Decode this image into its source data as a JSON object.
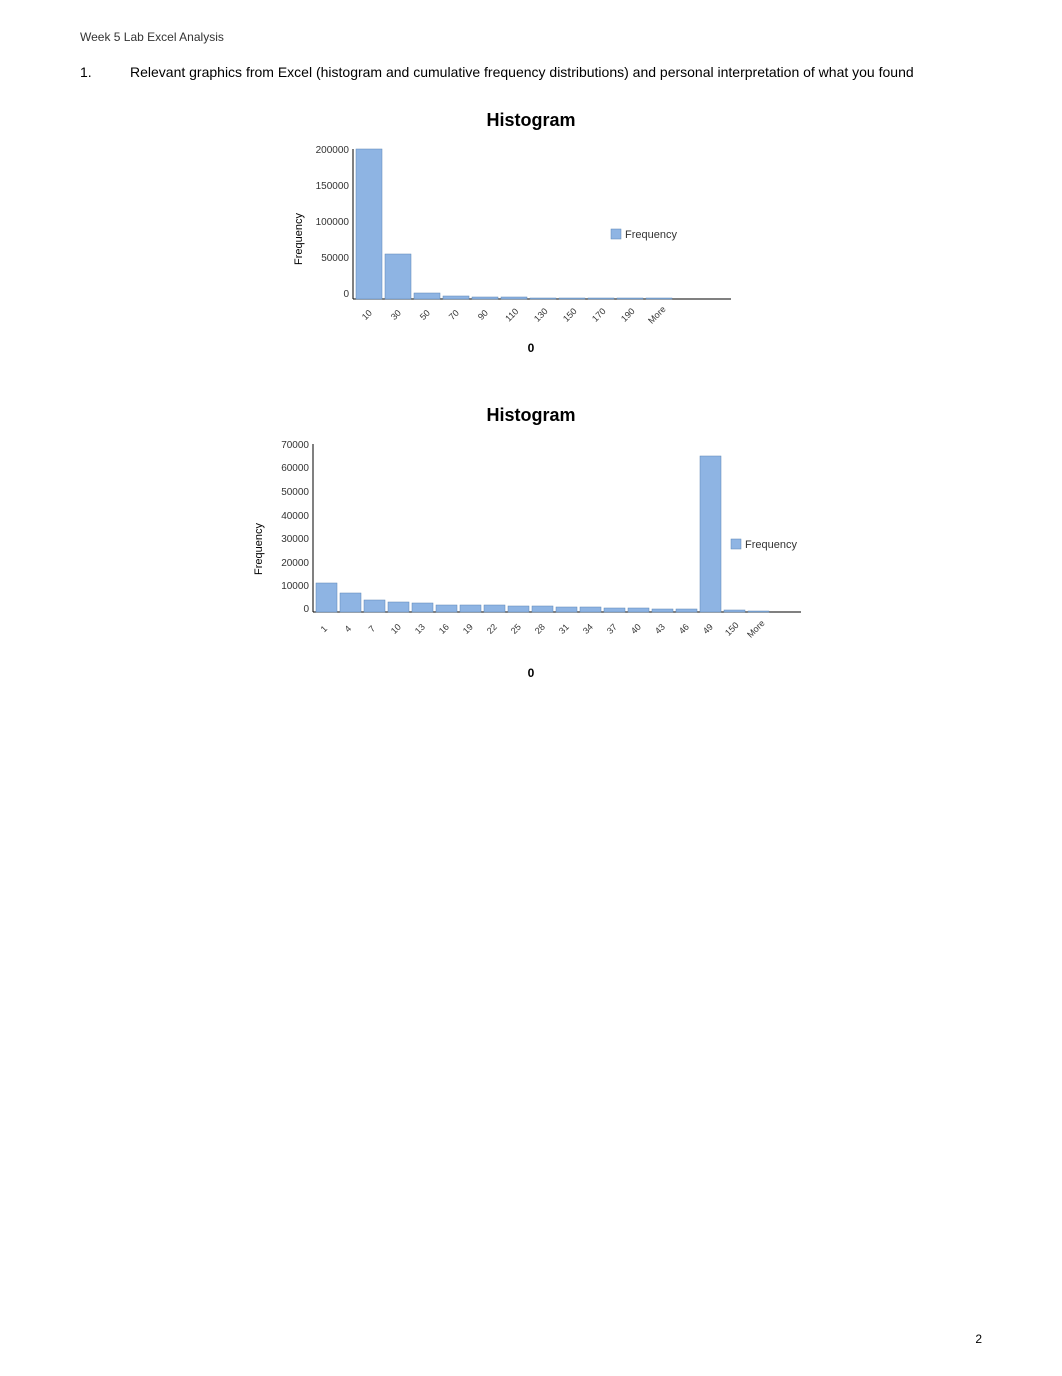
{
  "header": {
    "label": "Week 5 Lab Excel Analysis"
  },
  "question": {
    "number": "1.",
    "text": "Relevant graphics from Excel (histogram and cumulative frequency distributions) and personal interpretation of what you found"
  },
  "chart1": {
    "title": "Histogram",
    "y_axis_label": "Frequency",
    "x_axis_label": "0",
    "legend_label": "Frequency",
    "y_ticks": [
      "200000",
      "150000",
      "100000",
      "50000",
      "0"
    ],
    "x_ticks": [
      "10",
      "30",
      "50",
      "70",
      "90",
      "110",
      "130",
      "150",
      "170",
      "190",
      "More"
    ],
    "bars": [
      180000,
      60000,
      8000,
      3000,
      2000,
      1500,
      1200,
      1000,
      800,
      500,
      200
    ]
  },
  "chart2": {
    "title": "Histogram",
    "y_axis_label": "Frequency",
    "x_axis_label": "0",
    "legend_label": "Frequency",
    "y_ticks": [
      "70000",
      "60000",
      "50000",
      "40000",
      "30000",
      "20000",
      "10000",
      "0"
    ],
    "x_ticks": [
      "1",
      "4",
      "7",
      "10",
      "13",
      "16",
      "19",
      "22",
      "25",
      "28",
      "31",
      "34",
      "37",
      "40",
      "43",
      "46",
      "49",
      "150",
      "More"
    ],
    "bars": [
      12000,
      8000,
      5000,
      4000,
      3500,
      3000,
      3000,
      2800,
      2600,
      2400,
      2200,
      2000,
      1800,
      1600,
      1400,
      1200,
      65000,
      1000,
      500
    ]
  },
  "page_number": "2"
}
